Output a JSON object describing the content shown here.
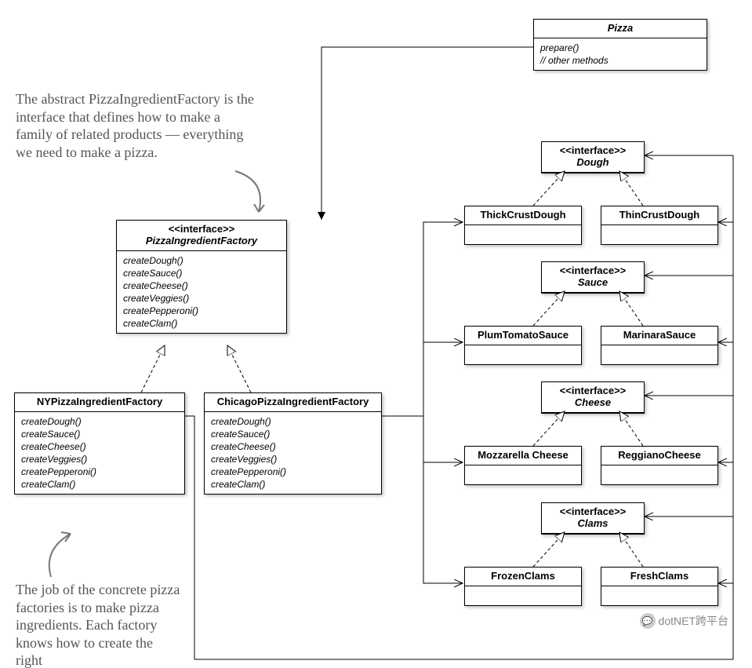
{
  "notes": {
    "top": "The abstract PizzaIngredientFactory is the interface that defines how to make a family of related products — everything we need to make a pizza.",
    "bottom": "The job of the concrete pizza factories is to make pizza ingredients. Each factory knows how to create the right"
  },
  "watermark": "dotNET跨平台",
  "classes": {
    "pizza": {
      "name": "Pizza",
      "methods": [
        "prepare()",
        "// other methods"
      ]
    },
    "pif": {
      "stereo": "<<interface>>",
      "name": "PizzaIngredientFactory",
      "methods": [
        "createDough()",
        "createSauce()",
        "createCheese()",
        "createVeggies()",
        "createPepperoni()",
        "createClam()"
      ]
    },
    "ny": {
      "name": "NYPizzaIngredientFactory",
      "methods": [
        "createDough()",
        "createSauce()",
        "createCheese()",
        "createVeggies()",
        "createPepperoni()",
        "createClam()"
      ]
    },
    "chi": {
      "name": "ChicagoPizzaIngredientFactory",
      "methods": [
        "createDough()",
        "createSauce()",
        "createCheese()",
        "createVeggies()",
        "createPepperoni()",
        "createClam()"
      ]
    },
    "dough": {
      "stereo": "<<interface>>",
      "name": "Dough"
    },
    "thick": {
      "name": "ThickCrustDough"
    },
    "thin": {
      "name": "ThinCrustDough"
    },
    "sauce": {
      "stereo": "<<interface>>",
      "name": "Sauce"
    },
    "plum": {
      "name": "PlumTomatoSauce"
    },
    "mari": {
      "name": "MarinaraSauce"
    },
    "cheese": {
      "stereo": "<<interface>>",
      "name": "Cheese"
    },
    "mozz": {
      "name": "Mozzarella Cheese"
    },
    "regg": {
      "name": "ReggianoCheese"
    },
    "clams": {
      "stereo": "<<interface>>",
      "name": "Clams"
    },
    "froz": {
      "name": "FrozenClams"
    },
    "fresh": {
      "name": "FreshClams"
    }
  }
}
